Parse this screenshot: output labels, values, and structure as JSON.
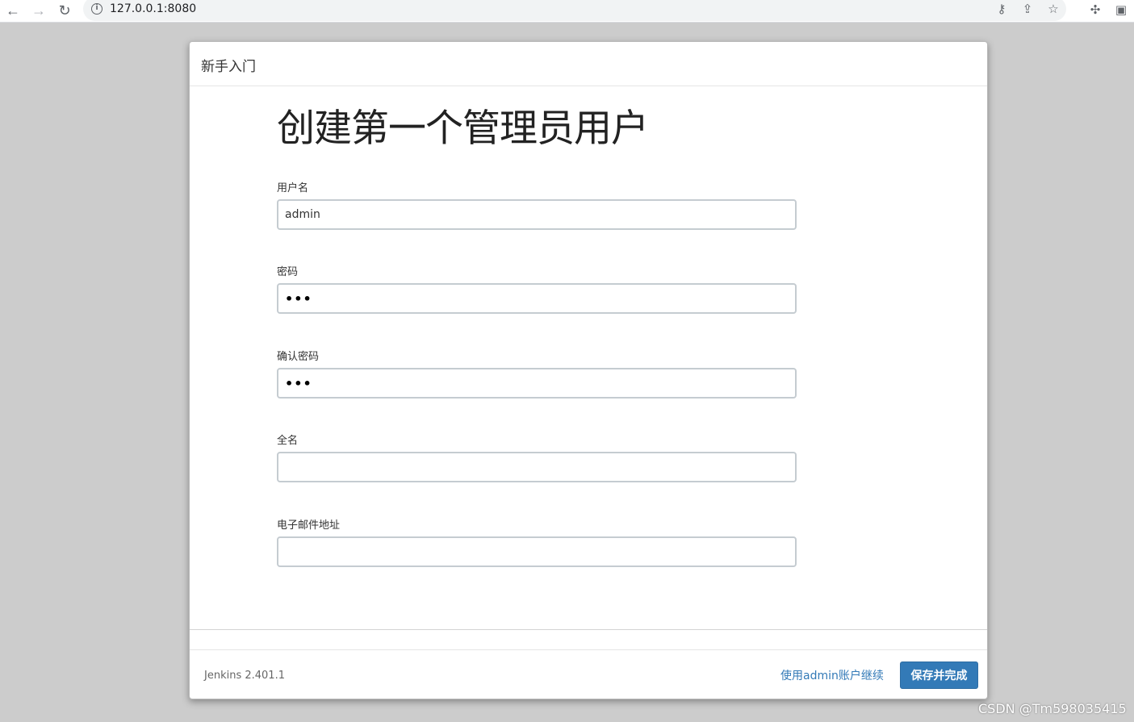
{
  "browser": {
    "url": "127.0.0.1:8080",
    "info_glyph": "i",
    "back_glyph": "←",
    "forward_glyph": "→",
    "reload_glyph": "↻",
    "key_glyph": "⚷",
    "share_glyph": "⇪",
    "star_glyph": "☆",
    "extensions_glyph": "✣",
    "sidepanel_glyph": "▣"
  },
  "modal": {
    "title": "新手入门",
    "heading": "创建第一个管理员用户",
    "fields": {
      "username": {
        "label": "用户名",
        "value": "admin"
      },
      "password": {
        "label": "密码",
        "value": "•••"
      },
      "confirm_password": {
        "label": "确认密码",
        "value": "•••"
      },
      "full_name": {
        "label": "全名",
        "value": ""
      },
      "email": {
        "label": "电子邮件地址",
        "value": ""
      }
    },
    "footer": {
      "version": "Jenkins 2.401.1",
      "continue_link": "使用admin账户继续",
      "save_button": "保存并完成"
    }
  },
  "watermark": "CSDN @Tm598035415",
  "colors": {
    "primary": "#337ab7",
    "backdrop": "#cccccc"
  }
}
